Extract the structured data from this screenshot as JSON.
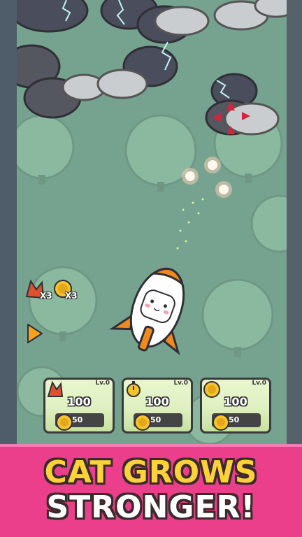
{
  "hud": {
    "fire_multiplier": "X3",
    "coin_multiplier": "X3"
  },
  "upgrades": [
    {
      "icon": "flame-icon",
      "level": "Lv.0",
      "amount": "100",
      "cost": "50"
    },
    {
      "icon": "stopwatch-icon",
      "level": "Lv.0",
      "amount": "100",
      "cost": "50"
    },
    {
      "icon": "coin-icon",
      "level": "Lv.0",
      "amount": "100",
      "cost": "50"
    }
  ],
  "banner": {
    "line1": "CAT GROWS",
    "line2": "STRONGER!"
  },
  "colors": {
    "field": "#76a38f",
    "tree": "#8ab9a0",
    "storm_cloud": "#3f4352",
    "light_cloud": "#c9cdcf",
    "banner": "#ec3f8b",
    "banner_title": "#ffd23a",
    "rocket_orange": "#f08a1e",
    "coin": "#f6c32c"
  }
}
